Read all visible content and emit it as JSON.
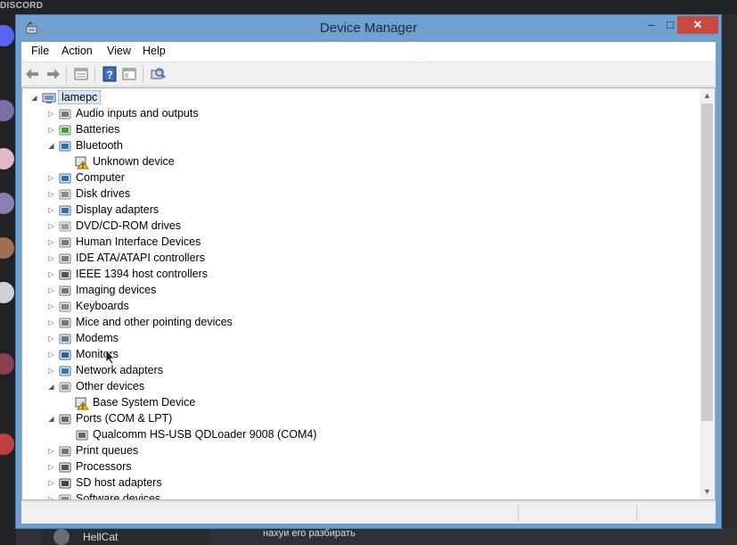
{
  "background_app": {
    "brand": "DISCORD",
    "user_name": "HellCat",
    "message_text": "нахуи его разбирать"
  },
  "window": {
    "title": "Device Manager",
    "controls": {
      "minimize": "–",
      "maximize": "□",
      "close": "✕"
    }
  },
  "menu": [
    "File",
    "Action",
    "View",
    "Help"
  ],
  "toolbar_icons": [
    "back-arrow-icon",
    "forward-arrow-icon",
    "properties-icon",
    "help-icon",
    "view-icon",
    "scan-hardware-icon"
  ],
  "tree": {
    "root": "lamepc",
    "items": [
      {
        "label": "Audio inputs and outputs",
        "level": 1,
        "state": "collapsed",
        "icon": "speaker-icon"
      },
      {
        "label": "Batteries",
        "level": 1,
        "state": "collapsed",
        "icon": "battery-icon"
      },
      {
        "label": "Bluetooth",
        "level": 1,
        "state": "expanded",
        "icon": "bluetooth-icon"
      },
      {
        "label": "Unknown device",
        "level": 2,
        "state": "leaf",
        "icon": "warning-device-icon"
      },
      {
        "label": "Computer",
        "level": 1,
        "state": "collapsed",
        "icon": "computer-icon"
      },
      {
        "label": "Disk drives",
        "level": 1,
        "state": "collapsed",
        "icon": "disk-drive-icon"
      },
      {
        "label": "Display adapters",
        "level": 1,
        "state": "collapsed",
        "icon": "display-adapter-icon"
      },
      {
        "label": "DVD/CD-ROM drives",
        "level": 1,
        "state": "collapsed",
        "icon": "dvd-drive-icon"
      },
      {
        "label": "Human Interface Devices",
        "level": 1,
        "state": "collapsed",
        "icon": "hid-icon"
      },
      {
        "label": "IDE ATA/ATAPI controllers",
        "level": 1,
        "state": "collapsed",
        "icon": "ide-controller-icon"
      },
      {
        "label": "IEEE 1394 host controllers",
        "level": 1,
        "state": "collapsed",
        "icon": "firewire-icon"
      },
      {
        "label": "Imaging devices",
        "level": 1,
        "state": "collapsed",
        "icon": "camera-icon"
      },
      {
        "label": "Keyboards",
        "level": 1,
        "state": "collapsed",
        "icon": "keyboard-icon"
      },
      {
        "label": "Mice and other pointing devices",
        "level": 1,
        "state": "collapsed",
        "icon": "mouse-icon"
      },
      {
        "label": "Modems",
        "level": 1,
        "state": "collapsed",
        "icon": "modem-icon"
      },
      {
        "label": "Monitors",
        "level": 1,
        "state": "collapsed",
        "icon": "monitor-icon"
      },
      {
        "label": "Network adapters",
        "level": 1,
        "state": "collapsed",
        "icon": "network-adapter-icon"
      },
      {
        "label": "Other devices",
        "level": 1,
        "state": "expanded",
        "icon": "other-devices-icon"
      },
      {
        "label": "Base System Device",
        "level": 2,
        "state": "leaf",
        "icon": "warning-device-icon"
      },
      {
        "label": "Ports (COM & LPT)",
        "level": 1,
        "state": "expanded",
        "icon": "port-icon"
      },
      {
        "label": "Qualcomm HS-USB QDLoader 9008 (COM4)",
        "level": 2,
        "state": "leaf",
        "icon": "port-icon"
      },
      {
        "label": "Print queues",
        "level": 1,
        "state": "collapsed",
        "icon": "printer-icon"
      },
      {
        "label": "Processors",
        "level": 1,
        "state": "collapsed",
        "icon": "processor-icon"
      },
      {
        "label": "SD host adapters",
        "level": 1,
        "state": "collapsed",
        "icon": "sd-card-icon"
      },
      {
        "label": "Software devices",
        "level": 1,
        "state": "collapsed",
        "icon": "software-device-icon"
      }
    ]
  },
  "colors": {
    "title_bar": "#6fa0cf",
    "close_button": "#c74a3f",
    "selection": "#d9e8f7",
    "warning": "#f5c518"
  }
}
